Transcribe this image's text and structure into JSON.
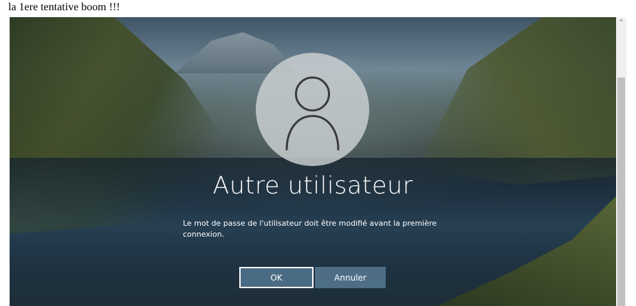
{
  "caption": "la 1ere tentative boom !!!",
  "login_screen": {
    "avatar_icon": "user-silhouette-icon",
    "user_name": "Autre utilisateur",
    "message": "Le mot de passe de l'utilisateur doit être modifié avant la première connexion.",
    "ok_label": "OK",
    "cancel_label": "Annuler"
  },
  "scrollbar": {
    "up_arrow_icon": "chevron-up-icon",
    "up_arrow_glyph": "^"
  },
  "colors": {
    "button_bg": "#4a6b84",
    "text": "#ffffff"
  }
}
